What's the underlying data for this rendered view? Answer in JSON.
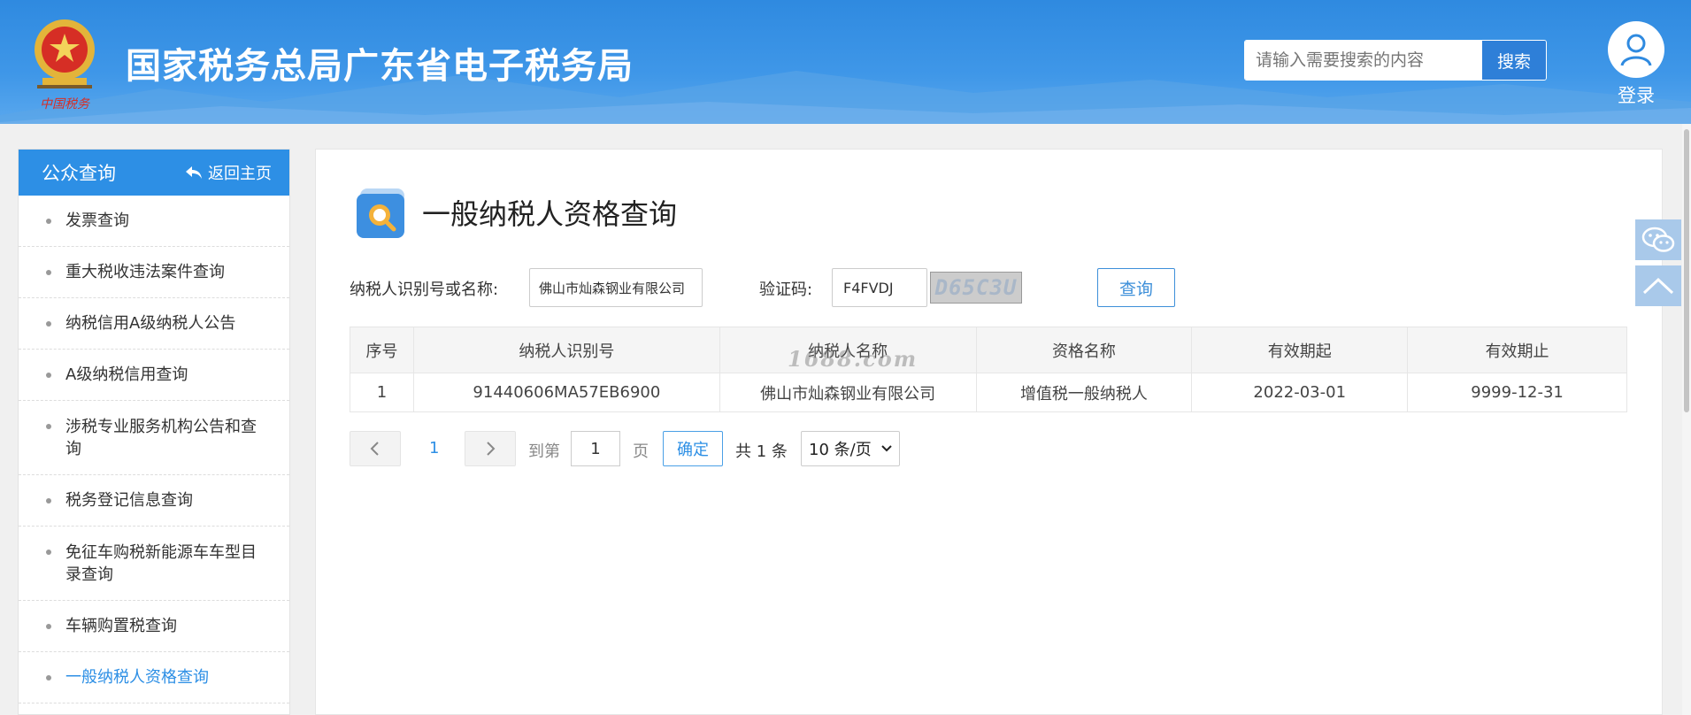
{
  "header": {
    "site_title": "国家税务总局广东省电子税务局",
    "emblem_text": "中国税务",
    "search_placeholder": "请输入需要搜索的内容",
    "search_button": "搜索",
    "login_label": "登录"
  },
  "sidebar": {
    "title": "公众查询",
    "back_label": "返回主页",
    "items": [
      {
        "label": "发票查询"
      },
      {
        "label": "重大税收违法案件查询"
      },
      {
        "label": "纳税信用A级纳税人公告"
      },
      {
        "label": "A级纳税信用查询"
      },
      {
        "label": "涉税专业服务机构公告和查询"
      },
      {
        "label": "税务登记信息查询"
      },
      {
        "label": "免征车购税新能源车车型目录查询"
      },
      {
        "label": "车辆购置税查询"
      },
      {
        "label": "一般纳税人资格查询"
      }
    ]
  },
  "main": {
    "page_title": "一般纳税人资格查询",
    "form": {
      "taxpayer_label": "纳税人识别号或名称:",
      "taxpayer_value": "佛山市灿森钢业有限公司",
      "captcha_label": "验证码:",
      "captcha_value": "F4FVDJ",
      "captcha_image_text": "D65C3U",
      "query_button": "查询"
    },
    "table": {
      "headers": [
        "序号",
        "纳税人识别号",
        "纳税人名称",
        "资格名称",
        "有效期起",
        "有效期止"
      ],
      "rows": [
        [
          "1",
          "91440606MA57EB6900",
          "佛山市灿森钢业有限公司",
          "增值税一般纳税人",
          "2022-03-01",
          "9999-12-31"
        ]
      ]
    },
    "watermark": "1688.com",
    "pager": {
      "current_page": "1",
      "goto_label": "到第",
      "goto_value": "1",
      "page_unit": "页",
      "confirm_button": "确定",
      "total_text": "共 1 条",
      "page_size": "10 条/页"
    }
  },
  "colors": {
    "header_blue": "#3f97e8",
    "sidebar_head_blue": "#2d8fe5",
    "active_link": "#2d8fe5",
    "float_tool": "#a9c9ea"
  },
  "icons": [
    "national-emblem-icon",
    "user-avatar-icon",
    "back-arrow-icon",
    "search-document-icon",
    "chevron-left-icon",
    "chevron-right-icon",
    "chevron-down-icon",
    "wechat-icon",
    "back-to-top-icon"
  ]
}
